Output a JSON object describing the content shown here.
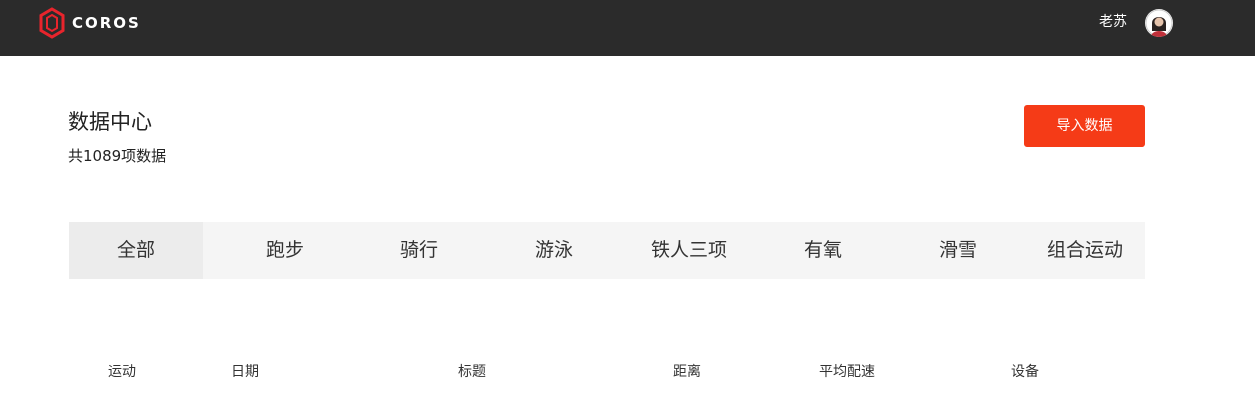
{
  "header": {
    "brand": "COROS",
    "username": "老苏",
    "accent_color": "#f53b17",
    "bar_color": "#2b2b2b"
  },
  "main": {
    "title": "数据中心",
    "count_text": "共1089项数据",
    "import_label": "导入数据"
  },
  "tabs": [
    {
      "label": "全部",
      "active": true
    },
    {
      "label": "跑步"
    },
    {
      "label": "骑行"
    },
    {
      "label": "游泳"
    },
    {
      "label": "铁人三项"
    },
    {
      "label": "有氧"
    },
    {
      "label": "滑雪"
    },
    {
      "label": "组合运动"
    }
  ],
  "table": {
    "columns": [
      "运动",
      "日期",
      "标题",
      "距离",
      "平均配速",
      "设备"
    ]
  }
}
